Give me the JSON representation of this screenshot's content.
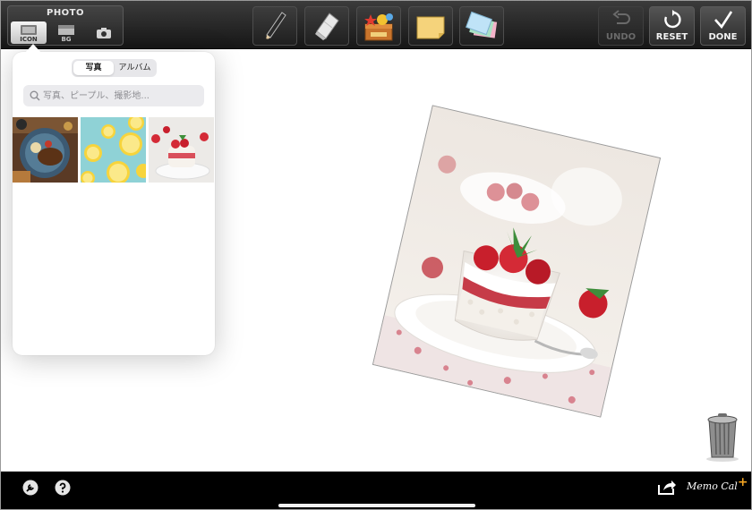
{
  "toolbar": {
    "photo_group": {
      "title": "PHOTO",
      "segments": [
        {
          "label": "ICON",
          "icon": "photo-icon",
          "selected": true
        },
        {
          "label": "BG",
          "icon": "background-icon",
          "selected": false
        },
        {
          "label": "",
          "icon": "camera-icon",
          "selected": false
        }
      ]
    },
    "tools": [
      {
        "name": "pen",
        "icon": "pencil-icon"
      },
      {
        "name": "eraser",
        "icon": "eraser-icon"
      },
      {
        "name": "stamp",
        "icon": "stamp-box-icon"
      },
      {
        "name": "note",
        "icon": "sticky-note-icon"
      },
      {
        "name": "cards",
        "icon": "cards-icon"
      }
    ],
    "undo_label": "UNDO",
    "undo_enabled": false,
    "reset_label": "RESET",
    "done_label": "DONE"
  },
  "popover": {
    "source_tabs": [
      {
        "label": "写真",
        "selected": true
      },
      {
        "label": "アルバム",
        "selected": false
      }
    ],
    "search": {
      "placeholder": "写真、ピープル、撮影地...",
      "value": ""
    },
    "thumbnails": [
      {
        "subject": "food plate"
      },
      {
        "subject": "lemon slices"
      },
      {
        "subject": "strawberry dessert"
      }
    ]
  },
  "canvas": {
    "photo": {
      "subject": "strawberry dessert",
      "rotation_deg": 13
    },
    "trash_icon": "trash-can-icon"
  },
  "bottom_bar": {
    "settings_icon": "wrench-icon",
    "help_icon": "question-icon",
    "share_icon": "share-icon",
    "brand": "Memo Cal",
    "brand_plus": "+"
  },
  "colors": {
    "toolbar_bg": "#1e1e1e",
    "brand_plus": "#f5a623",
    "bottom_bar_bg": "#000000"
  }
}
